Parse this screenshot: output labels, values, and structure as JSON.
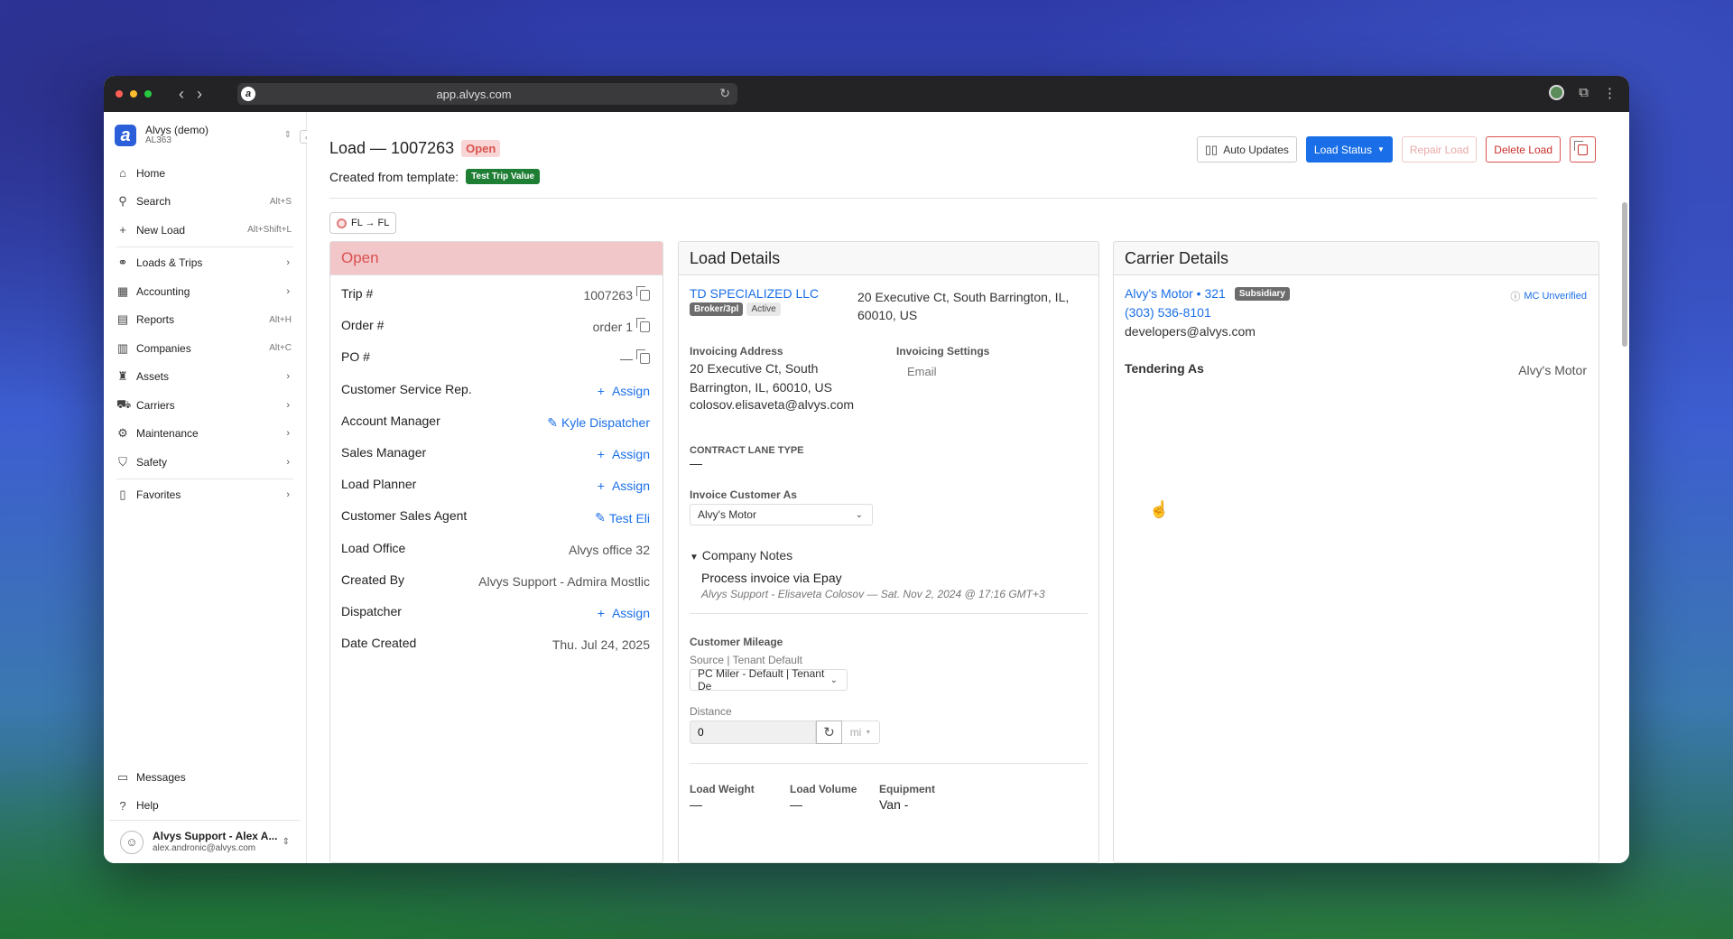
{
  "browser": {
    "url": "app.alvys.com"
  },
  "org": {
    "name": "Alvys (demo)",
    "code": "AL363",
    "logo_letter": "a"
  },
  "nav": {
    "items": [
      {
        "label": "Home",
        "icon": "home-icon",
        "kbd": ""
      },
      {
        "label": "Search",
        "icon": "search-icon",
        "kbd": "Alt+S"
      },
      {
        "label": "New Load",
        "icon": "plus-icon",
        "kbd": "Alt+Shift+L"
      }
    ],
    "groups": [
      {
        "label": "Loads & Trips",
        "icon": "route-icon",
        "kbd": "",
        "chevron": "›"
      },
      {
        "label": "Accounting",
        "icon": "calculator-icon",
        "kbd": "",
        "chevron": "›"
      },
      {
        "label": "Reports",
        "icon": "report-icon",
        "kbd": "Alt+H",
        "chevron": ""
      },
      {
        "label": "Companies",
        "icon": "building-icon",
        "kbd": "Alt+C",
        "chevron": ""
      },
      {
        "label": "Assets",
        "icon": "assets-icon",
        "kbd": "",
        "chevron": "›"
      },
      {
        "label": "Carriers",
        "icon": "truck-icon",
        "kbd": "",
        "chevron": "›"
      },
      {
        "label": "Maintenance",
        "icon": "wrench-icon",
        "kbd": "",
        "chevron": "›"
      },
      {
        "label": "Safety",
        "icon": "shield-icon",
        "kbd": "",
        "chevron": "›"
      }
    ],
    "favorites": {
      "label": "Favorites",
      "chevron": "›"
    },
    "messages": "Messages",
    "help": "Help"
  },
  "user": {
    "name": "Alvys Support - Alex A...",
    "email": "alex.andronic@alvys.com"
  },
  "header": {
    "title": "Load — 1007263",
    "status": "Open",
    "created_from_label": "Created from template:",
    "template_name": "Test Trip Value",
    "route": "FL → FL",
    "actions": {
      "auto_updates": "Auto Updates",
      "load_status": "Load Status",
      "repair_load": "Repair Load",
      "delete_load": "Delete Load"
    }
  },
  "status_card": {
    "title": "Open",
    "rows": [
      {
        "label": "Trip #",
        "value": "1007263",
        "kind": "copy"
      },
      {
        "label": "Order #",
        "value": "order 1",
        "kind": "copy"
      },
      {
        "label": "PO #",
        "value": "—",
        "kind": "copy"
      },
      {
        "label": "Customer Service Rep.",
        "value": "Assign",
        "kind": "assign"
      },
      {
        "label": "Account Manager",
        "value": "Kyle Dispatcher",
        "kind": "edit"
      },
      {
        "label": "Sales Manager",
        "value": "Assign",
        "kind": "assign"
      },
      {
        "label": "Load Planner",
        "value": "Assign",
        "kind": "assign"
      },
      {
        "label": "Customer Sales Agent",
        "value": "Test Eli",
        "kind": "edit"
      },
      {
        "label": "Load Office",
        "value": "Alvys office 32",
        "kind": "text"
      },
      {
        "label": "Created By",
        "value": "Alvys Support - Admira Mostlic",
        "kind": "text"
      },
      {
        "label": "Dispatcher",
        "value": "Assign",
        "kind": "assign"
      },
      {
        "label": "Date Created",
        "value": "Thu. Jul 24, 2025",
        "kind": "text"
      }
    ]
  },
  "load_details": {
    "title": "Load Details",
    "customer_name": "TD SPECIALIZED LLC",
    "customer_badge_type": "Broker/3pl",
    "customer_badge_status": "Active",
    "customer_address": "20 Executive Ct, South Barrington, IL, 60010, US",
    "invoicing_address_label": "Invoicing Address",
    "invoicing_address": "20 Executive Ct, South Barrington, IL, 60010, US",
    "invoicing_email": "colosov.elisaveta@alvys.com",
    "invoicing_settings_label": "Invoicing Settings",
    "invoicing_settings_value": "Email",
    "contract_lane_label": "CONTRACT LANE TYPE",
    "contract_lane_value": "—",
    "invoice_customer_as_label": "Invoice Customer As",
    "invoice_customer_as_value": "Alvy's Motor",
    "company_notes_label": "Company Notes",
    "note_text": "Process invoice via Epay",
    "note_meta": "Alvys Support - Elisaveta Colosov — Sat. Nov 2, 2024 @ 17:16 GMT+3",
    "customer_mileage_label": "Customer Mileage",
    "source_label": "Source | Tenant Default",
    "source_value": "PC Miler - Default | Tenant De",
    "distance_label": "Distance",
    "distance_value": "0",
    "distance_unit": "mi",
    "load_weight_label": "Load Weight",
    "load_weight_value": "—",
    "load_volume_label": "Load Volume",
    "load_volume_value": "—",
    "equipment_label": "Equipment",
    "equipment_value": "Van  -"
  },
  "carrier_details": {
    "title": "Carrier Details",
    "carrier_name": "Alvy's Motor • 321",
    "carrier_badge": "Subsidiary",
    "mc_status": "MC Unverified",
    "phone": "(303) 536-8101",
    "email": "developers@alvys.com",
    "tendering_label": "Tendering As",
    "tendering_value": "Alvy's Motor"
  },
  "colors": {
    "accent": "#1a6fe8",
    "open": "#d94f4f",
    "template_badge": "#1e7e34"
  }
}
